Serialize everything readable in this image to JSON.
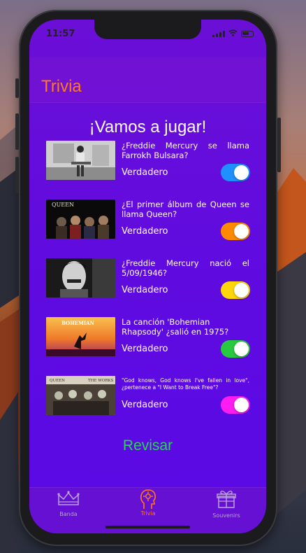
{
  "status_bar": {
    "time": "11:57"
  },
  "nav": {
    "title": "Trivia"
  },
  "heading": "¡Vamos a jugar!",
  "questions": [
    {
      "text": "¿Freddie Mercury se llama Farrokh Bulsara?",
      "answer_label": "Verdadero",
      "toggle_on": true,
      "toggle_color": "#1e90ff",
      "image": "freddie-sitting-photo"
    },
    {
      "text": "¿El primer álbum de Queen se llama Queen?",
      "answer_label": "Verdadero",
      "toggle_on": true,
      "toggle_color": "#ff8a00",
      "image": "queen-greatest-hits-cover",
      "image_caption": "QUEEN"
    },
    {
      "text": "¿Freddie Mercury nació el 5/09/1946?",
      "answer_label": "Verdadero",
      "toggle_on": true,
      "toggle_color": "#ffd60a",
      "image": "freddie-portrait-photo"
    },
    {
      "text": "La canción 'Bohemian Rhapsody' ¿salió en 1975?",
      "answer_label": "Verdadero",
      "toggle_on": true,
      "toggle_color": "#28c840",
      "image": "bohemian-rhapsody-poster",
      "image_caption": "BOHEMIAN"
    },
    {
      "text": "\"God knows, God knows I've fallen in love\", ¿pertenece a \"I Want to Break Free\"?",
      "answer_label": "Verdadero",
      "toggle_on": true,
      "toggle_color": "#ff1cf0",
      "image": "queen-the-works-cover",
      "image_caption_left": "QUEEN",
      "image_caption_right": "THE WORKS"
    }
  ],
  "revisar_label": "Revisar",
  "tabs": [
    {
      "label": "Banda",
      "icon": "crown-icon",
      "active": false
    },
    {
      "label": "Trivia",
      "icon": "trivia-person-icon",
      "active": true
    },
    {
      "label": "Souvenirs",
      "icon": "gift-icon",
      "active": false
    }
  ],
  "colors": {
    "accent": "#ff7a1a",
    "revisar": "#2ed158",
    "background": "#6b0fd6"
  }
}
